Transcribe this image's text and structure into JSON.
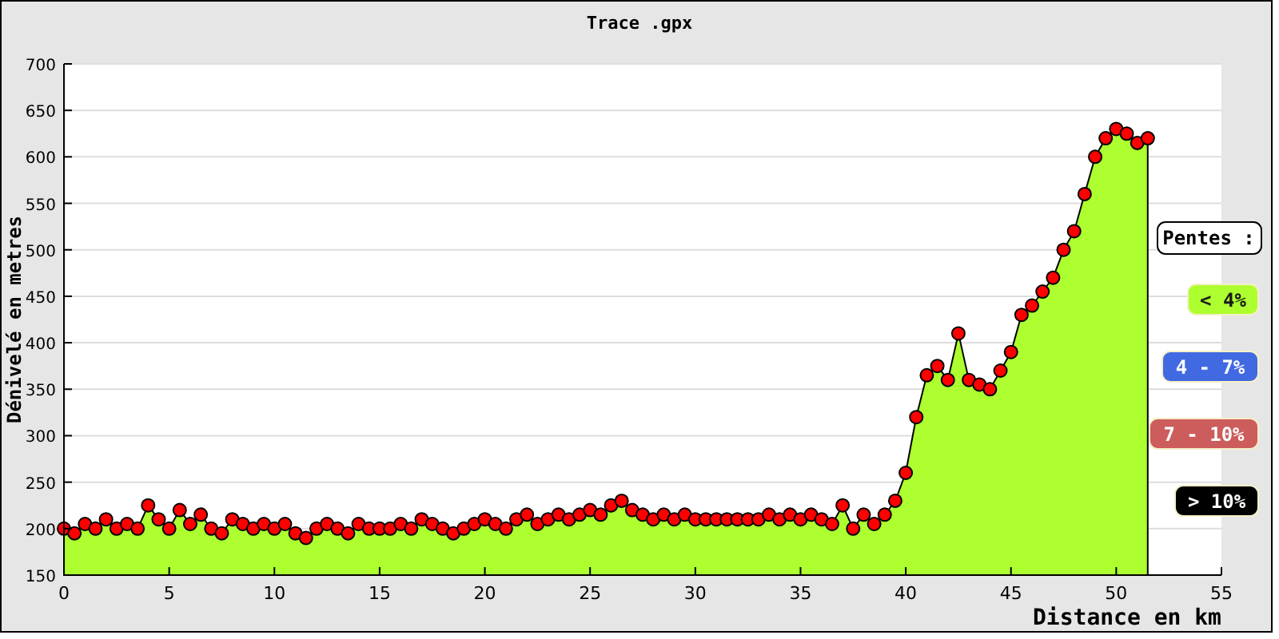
{
  "chart_data": {
    "type": "area",
    "title": "Trace .gpx",
    "xlabel": "Distance en km",
    "ylabel": "Dénivelé en metres",
    "x": [
      0,
      0.5,
      1,
      1.5,
      2,
      2.5,
      3,
      3.5,
      4,
      4.5,
      5,
      5.5,
      6,
      6.5,
      7,
      7.5,
      8,
      8.5,
      9,
      9.5,
      10,
      10.5,
      11,
      11.5,
      12,
      12.5,
      13,
      13.5,
      14,
      14.5,
      15,
      15.5,
      16,
      16.5,
      17,
      17.5,
      18,
      18.5,
      19,
      19.5,
      20,
      20.5,
      21,
      21.5,
      22,
      22.5,
      23,
      23.5,
      24,
      24.5,
      25,
      25.5,
      26,
      26.5,
      27,
      27.5,
      28,
      28.5,
      29,
      29.5,
      30,
      30.5,
      31,
      31.5,
      32,
      32.5,
      33,
      33.5,
      34,
      34.5,
      35,
      35.5,
      36,
      36.5,
      37,
      37.5,
      38,
      38.5,
      39,
      39.5,
      40,
      40.5,
      41,
      41.5,
      42,
      42.5,
      43,
      43.5,
      44,
      44.5,
      45,
      45.5,
      46,
      46.5,
      47,
      47.5,
      48,
      48.5,
      49,
      49.5,
      50,
      50.5,
      51,
      51.5
    ],
    "grid": true,
    "series": [
      {
        "color": "#adff2f",
        "values": [
          200,
          195,
          205,
          200,
          210,
          200,
          205,
          200,
          225,
          210,
          200,
          220,
          205,
          215,
          200,
          195,
          210,
          205,
          200,
          205,
          200,
          205,
          195,
          190,
          200,
          205,
          200,
          195,
          205,
          200,
          200,
          200,
          205,
          200,
          210,
          205,
          200,
          195,
          200,
          205,
          210,
          205,
          200,
          210,
          215,
          205,
          210,
          215,
          210,
          215,
          220,
          215,
          225,
          230,
          220,
          215,
          210,
          215,
          210,
          215,
          210,
          210,
          210,
          210,
          210,
          210,
          210,
          215,
          210,
          215,
          210,
          215,
          210,
          205,
          225,
          200,
          215,
          205,
          215,
          230,
          260,
          320,
          365,
          375,
          360,
          410,
          360,
          355,
          350,
          370,
          390,
          430,
          440,
          455,
          470,
          500,
          520,
          560,
          600,
          620,
          630,
          625,
          615,
          620
        ]
      }
    ],
    "xlim": [
      0,
      55
    ],
    "ylim": [
      150,
      700
    ],
    "xticks": [
      0,
      5,
      10,
      15,
      20,
      25,
      30,
      35,
      40,
      45,
      50,
      55
    ],
    "yticks": [
      150,
      200,
      250,
      300,
      350,
      400,
      450,
      500,
      550,
      600,
      650,
      700
    ]
  },
  "legend": {
    "title": "Pentes :",
    "items": [
      {
        "label": "< 4%",
        "color": "#adff2f"
      },
      {
        "label": "4 - 7%",
        "color": "#4169e1"
      },
      {
        "label": "7 - 10%",
        "color": "#cd5c5c"
      },
      {
        "label": "> 10%",
        "color": "#000000"
      }
    ]
  }
}
